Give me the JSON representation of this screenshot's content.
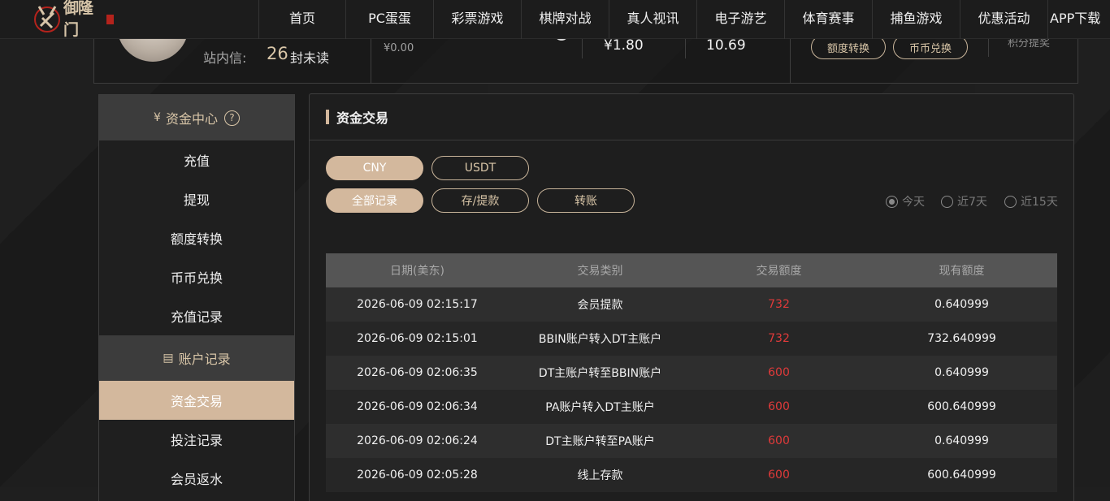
{
  "nav": {
    "items": [
      "首页",
      "PC蛋蛋",
      "彩票游戏",
      "棋牌对战",
      "真人视讯",
      "电子游艺",
      "体育赛事",
      "捕鱼游戏",
      "优惠活动",
      "APP下载"
    ]
  },
  "logo": {
    "text": "御隆门"
  },
  "user": {
    "msg_label": "站内信:",
    "msg_count": "26",
    "msg_unread": "封未读",
    "balance_main": "¥0.00",
    "balance_2": "¥1.80",
    "balance_3": "10.69",
    "btn_transfer": "额度转换",
    "btn_coin": "币币兑换",
    "points": "积分提奖"
  },
  "sidebar": {
    "section1_title": "资金中心",
    "section1_items": [
      "充值",
      "提现",
      "额度转换",
      "币币兑换",
      "充值记录"
    ],
    "section2_title": "账户记录",
    "section2_items": [
      "资金交易",
      "投注记录",
      "会员返水"
    ],
    "active": "资金交易"
  },
  "main": {
    "title": "资金交易",
    "currency_tabs": [
      "CNY",
      "USDT"
    ],
    "type_tabs": [
      "全部记录",
      "存/提款",
      "转账"
    ],
    "range_options": [
      "今天",
      "近7天",
      "近15天"
    ],
    "range_selected": "今天",
    "table": {
      "headers": [
        "日期(美东)",
        "交易类别",
        "交易额度",
        "现有额度"
      ],
      "rows": [
        [
          "2026-06-09 02:15:17",
          "会员提款",
          "732",
          "0.640999"
        ],
        [
          "2026-06-09 02:15:01",
          "BBIN账户转入DT主账户",
          "732",
          "732.640999"
        ],
        [
          "2026-06-09 02:06:35",
          "DT主账户转至BBIN账户",
          "600",
          "0.640999"
        ],
        [
          "2026-06-09 02:06:34",
          "PA账户转入DT主账户",
          "600",
          "600.640999"
        ],
        [
          "2026-06-09 02:06:24",
          "DT主账户转至PA账户",
          "600",
          "0.640999"
        ],
        [
          "2026-06-09 02:05:28",
          "线上存款",
          "600",
          "600.640999"
        ]
      ]
    }
  },
  "colors": {
    "accent": "#d3b89d",
    "amount": "#e03a3a",
    "header_bg": "#555555"
  }
}
